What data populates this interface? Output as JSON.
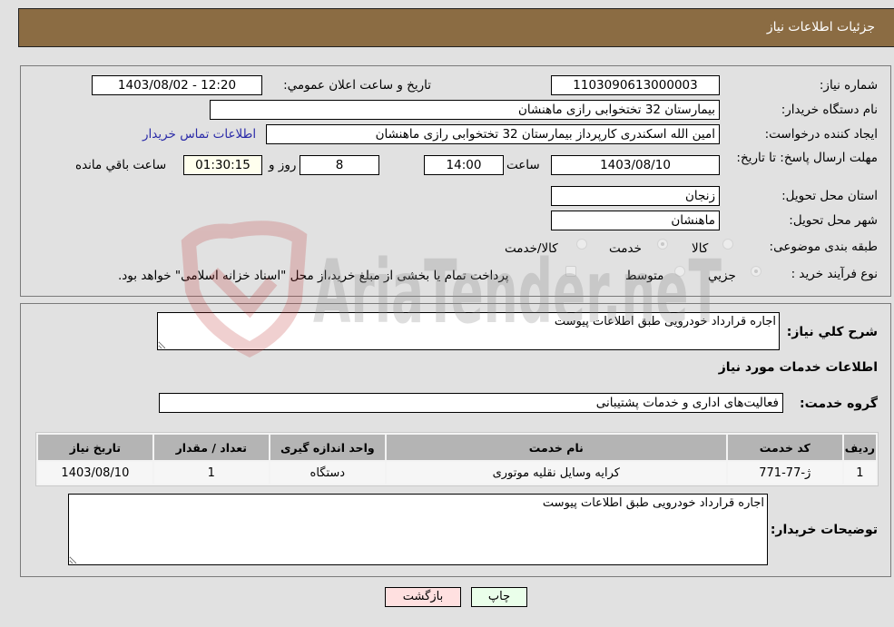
{
  "header": {
    "title": "جزئيات اطلاعات نياز"
  },
  "form": {
    "need_number": {
      "label": "شماره نیاز:",
      "value": "1103090613000003"
    },
    "announce_datetime": {
      "label": "تاريخ و ساعت اعلان عمومي:",
      "value": "1403/08/02 - 12:20"
    },
    "buyer_org": {
      "label": "نام دستگاه خریدار:",
      "value": "بیمارستان 32 تختخوابی رازی ماهنشان"
    },
    "requester": {
      "label": "ایجاد کننده درخواست:",
      "value": "امین الله اسکندری کارپرداز بیمارستان 32 تختخوابی رازی ماهنشان"
    },
    "buyer_contact_link": "اطلاعات تماس خریدار",
    "deadline": {
      "label": "مهلت ارسال پاسخ: تا تاریخ:",
      "date": "1403/08/10",
      "time_label": "ساعت",
      "time": "14:00",
      "days": "8",
      "days_label": "روز و",
      "remaining": "01:30:15",
      "remaining_label": "ساعت باقي مانده"
    },
    "province": {
      "label": "استان محل تحویل:",
      "value": "زنجان"
    },
    "city": {
      "label": "شهر محل تحویل:",
      "value": "ماهنشان"
    },
    "category": {
      "label": "طبقه بندی موضوعی:",
      "options": [
        "کالا",
        "خدمت",
        "کالا/خدمت"
      ],
      "selected": "خدمت"
    },
    "purchase_type": {
      "label": "نوع فرآیند خرید :",
      "options": [
        "جزيي",
        "متوسط"
      ],
      "selected": "جزيي",
      "treasury_note": "پرداخت تمام یا بخشی از مبلغ خرید،از محل \"اسناد خزانه اسلامی\" خواهد بود."
    }
  },
  "details": {
    "summary_label": "شرح کلي نياز:",
    "summary_value": "اجاره قرارداد خودرویی طبق اطلاعات پیوست",
    "services_heading": "اطلاعات خدمات مورد نياز",
    "service_group_label": "گروه خدمت:",
    "service_group_value": "فعالیت‌های اداری و خدمات پشتیبانی",
    "table": {
      "headers": [
        "رديف",
        "کد خدمت",
        "نام خدمت",
        "واحد اندازه گیری",
        "تعداد / مقدار",
        "تاريخ نياز"
      ],
      "rows": [
        [
          "1",
          "ژ-77-771",
          "کرایه وسایل نقلیه موتوری",
          "دستگاه",
          "1",
          "1403/08/10"
        ]
      ]
    },
    "buyer_notes_label": "توضیحات خریدار:",
    "buyer_notes_value": "اجاره قرارداد خودرویی طبق اطلاعات پیوست"
  },
  "buttons": {
    "print": "چاپ",
    "back": "بازگشت"
  },
  "watermark": "AriaTender.neT",
  "colors": {
    "header_bg": "#8b6c43",
    "print_btn": "#eaffea",
    "back_btn": "#ffe0e0",
    "link": "#2a2aa8"
  }
}
